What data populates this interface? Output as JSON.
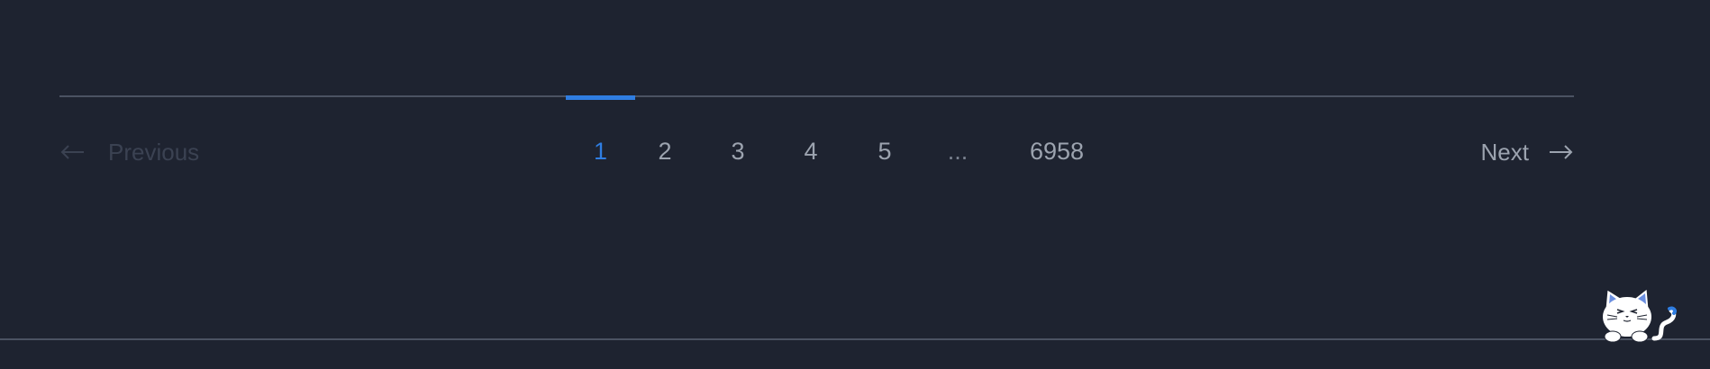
{
  "pagination": {
    "previous_label": "Previous",
    "next_label": "Next",
    "pages": [
      "1",
      "2",
      "3",
      "4",
      "5",
      "...",
      "6958"
    ],
    "current_page": "1"
  },
  "colors": {
    "background": "#1e2330",
    "accent": "#2f7de1",
    "text_muted": "#9ca3af",
    "text_disabled": "#3b4252",
    "rule": "#4b5262"
  },
  "icons": {
    "previous": "arrow-left-icon",
    "next": "arrow-right-icon",
    "mascot": "cat-mascot-icon"
  }
}
